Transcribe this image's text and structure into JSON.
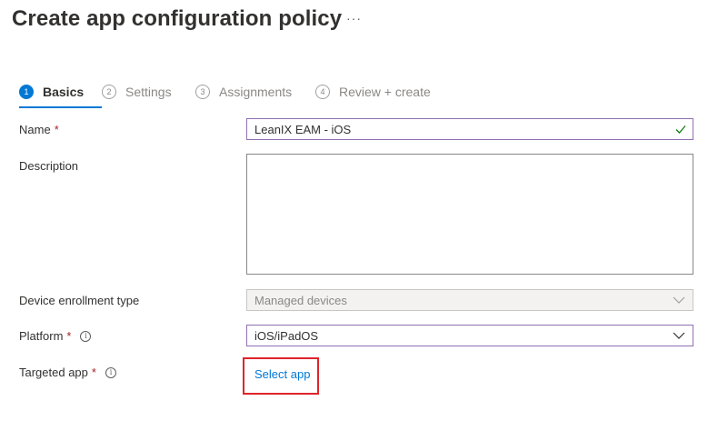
{
  "header": {
    "title": "Create app configuration policy",
    "more_label": "···"
  },
  "steps": [
    {
      "number": "1",
      "label": "Basics",
      "active": true
    },
    {
      "number": "2",
      "label": "Settings",
      "active": false
    },
    {
      "number": "3",
      "label": "Assignments",
      "active": false
    },
    {
      "number": "4",
      "label": "Review + create",
      "active": false
    }
  ],
  "form": {
    "name": {
      "label": "Name",
      "required": "*",
      "value": "LeanIX EAM - iOS",
      "valid": true
    },
    "description": {
      "label": "Description",
      "value": ""
    },
    "device_enrollment_type": {
      "label": "Device enrollment type",
      "value": "Managed devices",
      "disabled": true
    },
    "platform": {
      "label": "Platform",
      "required": "*",
      "info": "i",
      "value": "iOS/iPadOS"
    },
    "targeted_app": {
      "label": "Targeted app",
      "required": "*",
      "info": "i",
      "link_label": "Select app"
    }
  },
  "colors": {
    "accent": "#0078d4",
    "required": "#a4262c",
    "focus_border": "#8f6fb3",
    "valid_check": "#107c10",
    "highlight_box": "#e0242a"
  },
  "icons": {
    "more": "more-icon",
    "check": "checkmark-icon",
    "chevron": "chevron-down-icon",
    "info": "info-icon"
  }
}
